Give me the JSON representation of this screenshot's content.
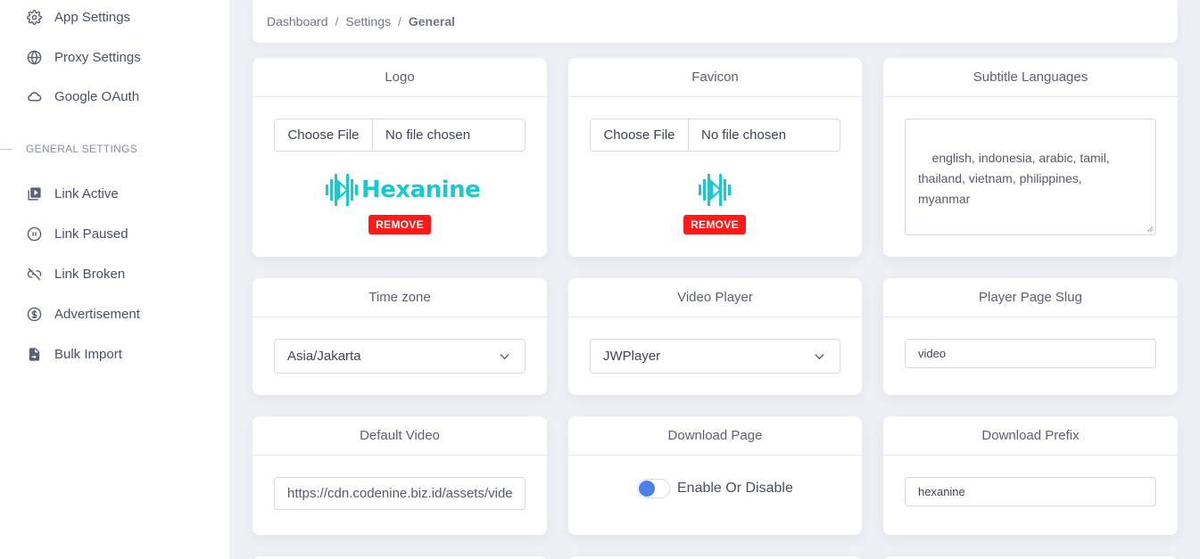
{
  "sidebar": {
    "items_top": [
      {
        "label": "App Settings",
        "icon": "gear-icon"
      },
      {
        "label": "Proxy Settings",
        "icon": "globe-icon"
      },
      {
        "label": "Google OAuth",
        "icon": "cloud-icon"
      }
    ],
    "section_title": "GENERAL SETTINGS",
    "items_general": [
      {
        "label": "Link Active",
        "icon": "play-box-icon"
      },
      {
        "label": "Link Paused",
        "icon": "pause-circle-icon"
      },
      {
        "label": "Link Broken",
        "icon": "broken-link-icon"
      },
      {
        "label": "Advertisement",
        "icon": "dollar-circle-icon"
      },
      {
        "label": "Bulk Import",
        "icon": "file-import-icon"
      }
    ]
  },
  "breadcrumb": {
    "items": [
      "Dashboard",
      "Settings",
      "General"
    ],
    "separator": "/"
  },
  "cards": {
    "logo": {
      "title": "Logo",
      "choose_label": "Choose File",
      "file_status": "No file chosen",
      "brand_text": "Hexanine",
      "remove_label": "REMOVE"
    },
    "favicon": {
      "title": "Favicon",
      "choose_label": "Choose File",
      "file_status": "No file chosen",
      "remove_label": "REMOVE"
    },
    "subtitle_languages": {
      "title": "Subtitle Languages",
      "value": "english, indonesia, arabic, tamil, thailand, vietnam, philippines, myanmar"
    },
    "time_zone": {
      "title": "Time zone",
      "selected": "Asia/Jakarta"
    },
    "video_player": {
      "title": "Video Player",
      "selected": "JWPlayer"
    },
    "player_page_slug": {
      "title": "Player Page Slug",
      "value": "video"
    },
    "default_video": {
      "title": "Default Video",
      "value": "https://cdn.codenine.biz.id/assets/vide"
    },
    "download_page": {
      "title": "Download Page",
      "toggle_label": "Enable Or Disable"
    },
    "download_prefix": {
      "title": "Download Prefix",
      "value": "hexanine"
    }
  },
  "colors": {
    "brand": "#18c9cf",
    "remove": "#ff1a1a",
    "toggle_knob": "#4a80ea"
  }
}
